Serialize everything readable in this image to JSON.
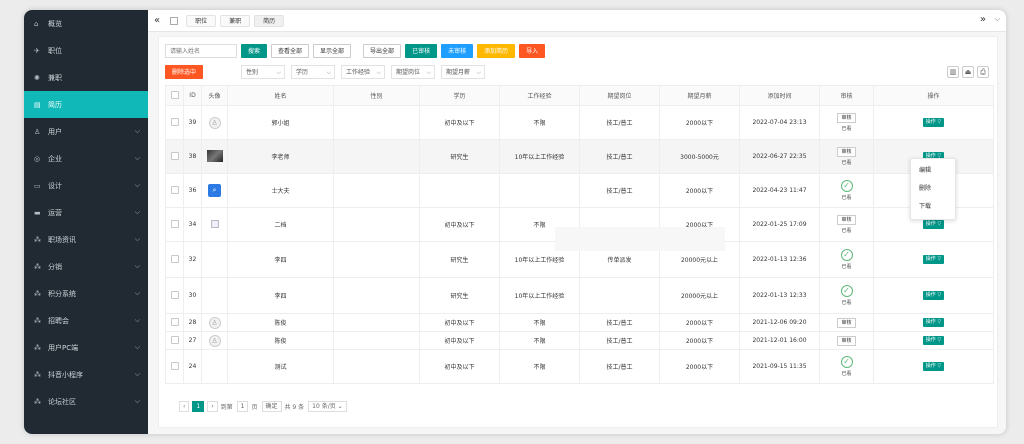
{
  "sidebar": {
    "items": [
      {
        "icon": "home-icon",
        "glyph": "⌂",
        "label": "概览",
        "chevron": false,
        "active": false
      },
      {
        "icon": "send-icon",
        "glyph": "✈",
        "label": "职位",
        "chevron": false,
        "active": false
      },
      {
        "icon": "settings-icon",
        "glyph": "✺",
        "label": "兼职",
        "chevron": false,
        "active": false
      },
      {
        "icon": "resume-icon",
        "glyph": "▤",
        "label": "简历",
        "chevron": false,
        "active": true
      },
      {
        "icon": "user-icon",
        "glyph": "♙",
        "label": "用户",
        "chevron": true,
        "active": false
      },
      {
        "icon": "company-icon",
        "glyph": "◎",
        "label": "企业",
        "chevron": true,
        "active": false
      },
      {
        "icon": "design-icon",
        "glyph": "▭",
        "label": "设计",
        "chevron": true,
        "active": false
      },
      {
        "icon": "operation-icon",
        "glyph": "▬",
        "label": "运营",
        "chevron": true,
        "active": false
      },
      {
        "icon": "news-icon",
        "glyph": "⁂",
        "label": "职场资讯",
        "chevron": true,
        "active": false
      },
      {
        "icon": "distribution-icon",
        "glyph": "⁂",
        "label": "分销",
        "chevron": true,
        "active": false
      },
      {
        "icon": "points-icon",
        "glyph": "⁂",
        "label": "积分系统",
        "chevron": true,
        "active": false
      },
      {
        "icon": "recruit-icon",
        "glyph": "⁂",
        "label": "招聘会",
        "chevron": true,
        "active": false
      },
      {
        "icon": "pc-user-icon",
        "glyph": "⁂",
        "label": "用户PC端",
        "chevron": true,
        "active": false
      },
      {
        "icon": "douyin-icon",
        "glyph": "⁂",
        "label": "抖音小程序",
        "chevron": true,
        "active": false
      },
      {
        "icon": "forum-icon",
        "glyph": "⁂",
        "label": "论坛社区",
        "chevron": true,
        "active": false
      }
    ]
  },
  "tabbar": {
    "back": "«",
    "tabs": [
      "职位",
      "兼职",
      "简历"
    ],
    "forward": "»"
  },
  "toolbar": {
    "search_placeholder": "请输入姓名",
    "search_button": "搜索",
    "view_all": "查看全部",
    "show_all": "显示全部",
    "export_all": "导出全部",
    "reviewed": "已审核",
    "unreviewed": "未审核",
    "add_resume": "添加简历",
    "import": "导入",
    "delete_selected": "删除选中",
    "filters": [
      "性别",
      "学历",
      "工作经验",
      "期望岗位",
      "期望月薪"
    ]
  },
  "table": {
    "headers": [
      "",
      "ID",
      "头像",
      "姓名",
      "性别",
      "学历",
      "工作经验",
      "期望岗位",
      "期望月薪",
      "添加时间",
      "审核",
      "操作"
    ],
    "rows": [
      {
        "id": "39",
        "avatar": "default",
        "name": "郭小姐",
        "gender": "",
        "edu": "初中及以下",
        "exp": "不限",
        "job": "技工/普工",
        "salary": "2000以下",
        "time": "2022-07-04 23:13",
        "review": "btn",
        "review_text": "已看"
      },
      {
        "id": "38",
        "avatar": "dark",
        "name": "李老师",
        "gender": "",
        "edu": "研究生",
        "exp": "10年以上工作经验",
        "job": "技工/普工",
        "salary": "3000-5000元",
        "time": "2022-06-27 22:35",
        "review": "btn",
        "review_text": "已看"
      },
      {
        "id": "36",
        "avatar": "blue",
        "name": "士大夫",
        "gender": "",
        "edu": "",
        "exp": "",
        "job": "技工/普工",
        "salary": "2000以下",
        "time": "2022-04-23 11:47",
        "review": "ok",
        "review_text": "已看"
      },
      {
        "id": "34",
        "avatar": "broken",
        "name": "二档",
        "gender": "",
        "edu": "初中及以下",
        "exp": "不限",
        "job": "",
        "salary": "2000以下",
        "time": "2022-01-25 17:09",
        "review": "btn",
        "review_text": "已看"
      },
      {
        "id": "32",
        "avatar": "none",
        "name": "李四",
        "gender": "",
        "edu": "研究生",
        "exp": "10年以上工作经验",
        "job": "传单派发",
        "salary": "20000元以上",
        "time": "2022-01-13 12:36",
        "review": "ok",
        "review_text": "已看"
      },
      {
        "id": "30",
        "avatar": "none",
        "name": "李四",
        "gender": "",
        "edu": "研究生",
        "exp": "10年以上工作经验",
        "job": "",
        "salary": "20000元以上",
        "time": "2022-01-13 12:33",
        "review": "ok",
        "review_text": "已看"
      },
      {
        "id": "28",
        "avatar": "default",
        "name": "陈俊",
        "gender": "",
        "edu": "初中及以下",
        "exp": "不限",
        "job": "技工/普工",
        "salary": "2000以下",
        "time": "2021-12-06 09:20",
        "review": "btn",
        "review_text": ""
      },
      {
        "id": "27",
        "avatar": "default",
        "name": "陈俊",
        "gender": "",
        "edu": "初中及以下",
        "exp": "不限",
        "job": "技工/普工",
        "salary": "2000以下",
        "time": "2021-12-01 16:00",
        "review": "btn",
        "review_text": ""
      },
      {
        "id": "24",
        "avatar": "none",
        "name": "测试",
        "gender": "",
        "edu": "初中及以下",
        "exp": "不限",
        "job": "技工/普工",
        "salary": "2000以下",
        "time": "2021-09-15 11:35",
        "review": "ok",
        "review_text": "已看"
      }
    ],
    "review_label": "审核",
    "op_label": "操作 ▽"
  },
  "dropdown": {
    "items": [
      "编辑",
      "删除",
      "下载"
    ]
  },
  "pager": {
    "prev": "‹",
    "current": "1",
    "next": "›",
    "goto_label": "到第",
    "goto_value": "1",
    "page_unit": "页",
    "confirm": "确定",
    "total": "共 9 条",
    "per_page": "10 条/页 ⌄"
  }
}
